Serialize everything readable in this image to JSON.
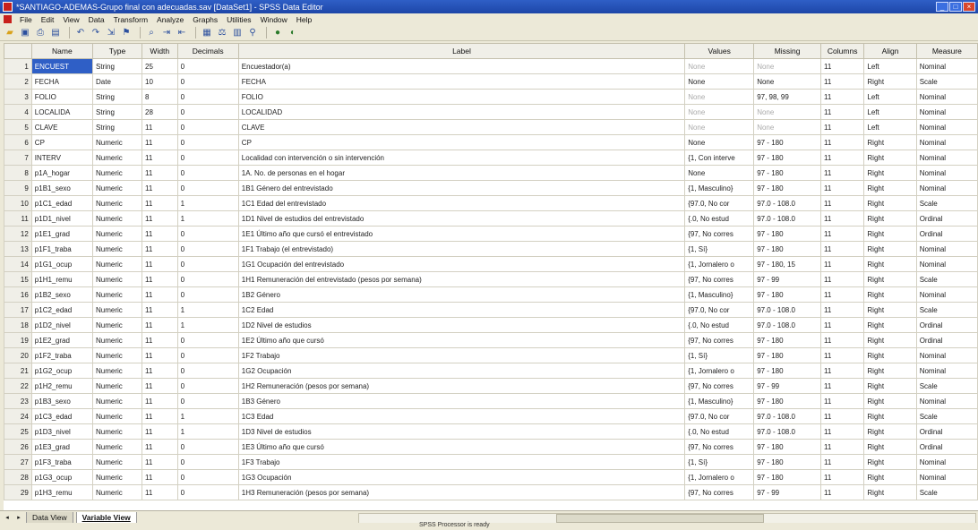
{
  "window": {
    "title": "*SANTIAGO-ADEMAS-Grupo final con adecuadas.sav [DataSet1] - SPSS Data Editor",
    "controls": [
      "_",
      "□",
      "×"
    ]
  },
  "menu": [
    "File",
    "Edit",
    "View",
    "Data",
    "Transform",
    "Analyze",
    "Graphs",
    "Utilities",
    "Window",
    "Help"
  ],
  "toolbar": [
    "open-icon",
    "save-icon",
    "print-icon",
    "dialog-recall-icon",
    "undo-icon",
    "redo-icon",
    "goto-case-icon",
    "variables-icon",
    "find-icon",
    "insert-cases-icon",
    "insert-variable-icon",
    "split-file-icon",
    "weight-cases-icon",
    "select-cases-icon",
    "value-labels-icon",
    "use-sets-icon",
    "show-all-icon"
  ],
  "columns": [
    "",
    "Name",
    "Type",
    "Width",
    "Decimals",
    "Label",
    "Values",
    "Missing",
    "Columns",
    "Align",
    "Measure"
  ],
  "rows": [
    [
      "1",
      "ENCUEST",
      "String",
      "25",
      "0",
      "Encuestador(a)",
      "None",
      "None",
      "11",
      "Left",
      "Nominal"
    ],
    [
      "2",
      "FECHA",
      "Date",
      "10",
      "0",
      "FECHA",
      "None",
      "None",
      "11",
      "Right",
      "Scale"
    ],
    [
      "3",
      "FOLIO",
      "String",
      "8",
      "0",
      "FOLIO",
      "None",
      "97, 98, 99",
      "11",
      "Left",
      "Nominal"
    ],
    [
      "4",
      "LOCALIDA",
      "String",
      "28",
      "0",
      "LOCALIDAD",
      "None",
      "None",
      "11",
      "Left",
      "Nominal"
    ],
    [
      "5",
      "CLAVE",
      "String",
      "11",
      "0",
      "CLAVE",
      "None",
      "None",
      "11",
      "Left",
      "Nominal"
    ],
    [
      "6",
      "CP",
      "Numeric",
      "11",
      "0",
      "CP",
      "None",
      "97 - 180",
      "11",
      "Right",
      "Nominal"
    ],
    [
      "7",
      "INTERV",
      "Numeric",
      "11",
      "0",
      "Localidad con intervención o sin intervención",
      "{1, Con interve",
      "97 - 180",
      "11",
      "Right",
      "Nominal"
    ],
    [
      "8",
      "p1A_hogar",
      "Numeric",
      "11",
      "0",
      "1A. No. de personas en el hogar",
      "None",
      "97 - 180",
      "11",
      "Right",
      "Nominal"
    ],
    [
      "9",
      "p1B1_sexo",
      "Numeric",
      "11",
      "0",
      "1B1 Género del entrevistado",
      "{1, Masculino}",
      "97 - 180",
      "11",
      "Right",
      "Nominal"
    ],
    [
      "10",
      "p1C1_edad",
      "Numeric",
      "11",
      "1",
      "1C1 Edad del entrevistado",
      "{97.0, No cor",
      "97.0 - 108.0",
      "11",
      "Right",
      "Scale"
    ],
    [
      "11",
      "p1D1_nivel",
      "Numeric",
      "11",
      "1",
      "1D1 Nivel de estudios del entrevistado",
      "{.0, No estud",
      "97.0 - 108.0",
      "11",
      "Right",
      "Ordinal"
    ],
    [
      "12",
      "p1E1_grad",
      "Numeric",
      "11",
      "0",
      "1E1 Último año que cursó el entrevistado",
      "{97, No corres",
      "97 - 180",
      "11",
      "Right",
      "Ordinal"
    ],
    [
      "13",
      "p1F1_traba",
      "Numeric",
      "11",
      "0",
      "1F1 Trabajo (el entrevistado)",
      "{1, Sí}",
      "97 - 180",
      "11",
      "Right",
      "Nominal"
    ],
    [
      "14",
      "p1G1_ocup",
      "Numeric",
      "11",
      "0",
      "1G1 Ocupación del entrevistado",
      "{1, Jornalero o",
      "97 - 180, 15",
      "11",
      "Right",
      "Nominal"
    ],
    [
      "15",
      "p1H1_remu",
      "Numeric",
      "11",
      "0",
      "1H1 Remuneración del entrevistado (pesos por semana)",
      "{97, No corres",
      "97 - 99",
      "11",
      "Right",
      "Scale"
    ],
    [
      "16",
      "p1B2_sexo",
      "Numeric",
      "11",
      "0",
      "1B2 Género",
      "{1, Masculino}",
      "97 - 180",
      "11",
      "Right",
      "Nominal"
    ],
    [
      "17",
      "p1C2_edad",
      "Numeric",
      "11",
      "1",
      "1C2 Edad",
      "{97.0, No cor",
      "97.0 - 108.0",
      "11",
      "Right",
      "Scale"
    ],
    [
      "18",
      "p1D2_nivel",
      "Numeric",
      "11",
      "1",
      "1D2 Nivel de estudios",
      "{.0, No estud",
      "97.0 - 108.0",
      "11",
      "Right",
      "Ordinal"
    ],
    [
      "19",
      "p1E2_grad",
      "Numeric",
      "11",
      "0",
      "1E2 Último año que cursó",
      "{97, No corres",
      "97 - 180",
      "11",
      "Right",
      "Ordinal"
    ],
    [
      "20",
      "p1F2_traba",
      "Numeric",
      "11",
      "0",
      "1F2 Trabajo",
      "{1, Sí}",
      "97 - 180",
      "11",
      "Right",
      "Nominal"
    ],
    [
      "21",
      "p1G2_ocup",
      "Numeric",
      "11",
      "0",
      "1G2 Ocupación",
      "{1, Jornalero o",
      "97 - 180",
      "11",
      "Right",
      "Nominal"
    ],
    [
      "22",
      "p1H2_remu",
      "Numeric",
      "11",
      "0",
      "1H2 Remuneración (pesos por semana)",
      "{97, No corres",
      "97 - 99",
      "11",
      "Right",
      "Scale"
    ],
    [
      "23",
      "p1B3_sexo",
      "Numeric",
      "11",
      "0",
      "1B3 Género",
      "{1, Masculino}",
      "97 - 180",
      "11",
      "Right",
      "Nominal"
    ],
    [
      "24",
      "p1C3_edad",
      "Numeric",
      "11",
      "1",
      "1C3 Edad",
      "{97.0, No cor",
      "97.0 - 108.0",
      "11",
      "Right",
      "Scale"
    ],
    [
      "25",
      "p1D3_nivel",
      "Numeric",
      "11",
      "1",
      "1D3 Nivel de estudios",
      "{.0, No estud",
      "97.0 - 108.0",
      "11",
      "Right",
      "Ordinal"
    ],
    [
      "26",
      "p1E3_grad",
      "Numeric",
      "11",
      "0",
      "1E3 Último año que cursó",
      "{97, No corres",
      "97 - 180",
      "11",
      "Right",
      "Ordinal"
    ],
    [
      "27",
      "p1F3_traba",
      "Numeric",
      "11",
      "0",
      "1F3 Trabajo",
      "{1, Sí}",
      "97 - 180",
      "11",
      "Right",
      "Nominal"
    ],
    [
      "28",
      "p1G3_ocup",
      "Numeric",
      "11",
      "0",
      "1G3 Ocupación",
      "{1, Jornalero o",
      "97 - 180",
      "11",
      "Right",
      "Nominal"
    ],
    [
      "29",
      "p1H3_remu",
      "Numeric",
      "11",
      "0",
      "1H3 Remuneración (pesos por semana)",
      "{97, No corres",
      "97 - 99",
      "11",
      "Right",
      "Scale"
    ]
  ],
  "tabs": [
    "Data View",
    "Variable View"
  ],
  "active_tab": "Variable View",
  "status": "SPSS Processor is ready"
}
